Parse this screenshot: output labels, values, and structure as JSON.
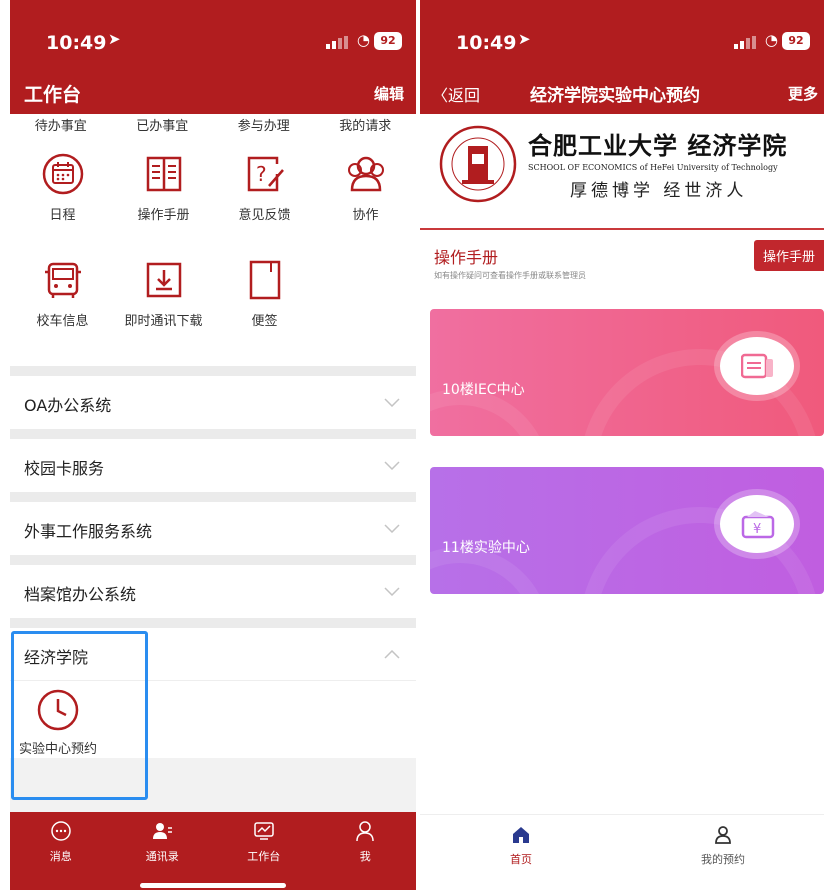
{
  "left": {
    "status": {
      "time": "10:49",
      "battery": "92"
    },
    "header": {
      "title": "工作台",
      "edit": "编辑"
    },
    "tabs": [
      "待办事宜",
      "已办事宜",
      "参与办理",
      "我的请求"
    ],
    "grid": [
      {
        "label": "日程",
        "icon": "calendar-icon"
      },
      {
        "label": "操作手册",
        "icon": "book-icon"
      },
      {
        "label": "意见反馈",
        "icon": "feedback-icon"
      },
      {
        "label": "协作",
        "icon": "people-icon"
      },
      {
        "label": "校车信息",
        "icon": "bus-icon"
      },
      {
        "label": "即时通讯下载",
        "icon": "download-icon"
      },
      {
        "label": "便签",
        "icon": "note-icon"
      }
    ],
    "sections": [
      "OA办公系统",
      "校园卡服务",
      "外事工作服务系统",
      "档案馆办公系统"
    ],
    "econ": {
      "title": "经济学院",
      "item": "实验中心预约"
    },
    "tabbar": [
      "消息",
      "通讯录",
      "工作台",
      "我"
    ]
  },
  "right": {
    "status": {
      "time": "10:49",
      "battery": "92"
    },
    "header": {
      "back": "返回",
      "title": "经济学院实验中心预约",
      "more": "更多"
    },
    "banner": {
      "name": "合肥工业大学 经济学院",
      "subtitle": "SCHOOL OF ECONOMICS of HeFei University of Technology",
      "motto": "厚德博学 经世济人"
    },
    "manual": {
      "title": "操作手册",
      "subtitle": "如有操作疑问可查看操作手册或联系管理员",
      "button": "操作手册"
    },
    "cards": [
      {
        "label": "10楼IEC中心",
        "color": "#f06a93"
      },
      {
        "label": "11楼实验中心",
        "color": "#bb68e6"
      }
    ],
    "tabbar": [
      "首页",
      "我的预约"
    ]
  },
  "colors": {
    "brand_red": "#b11d1f",
    "highlight_blue": "#2a8df0"
  }
}
